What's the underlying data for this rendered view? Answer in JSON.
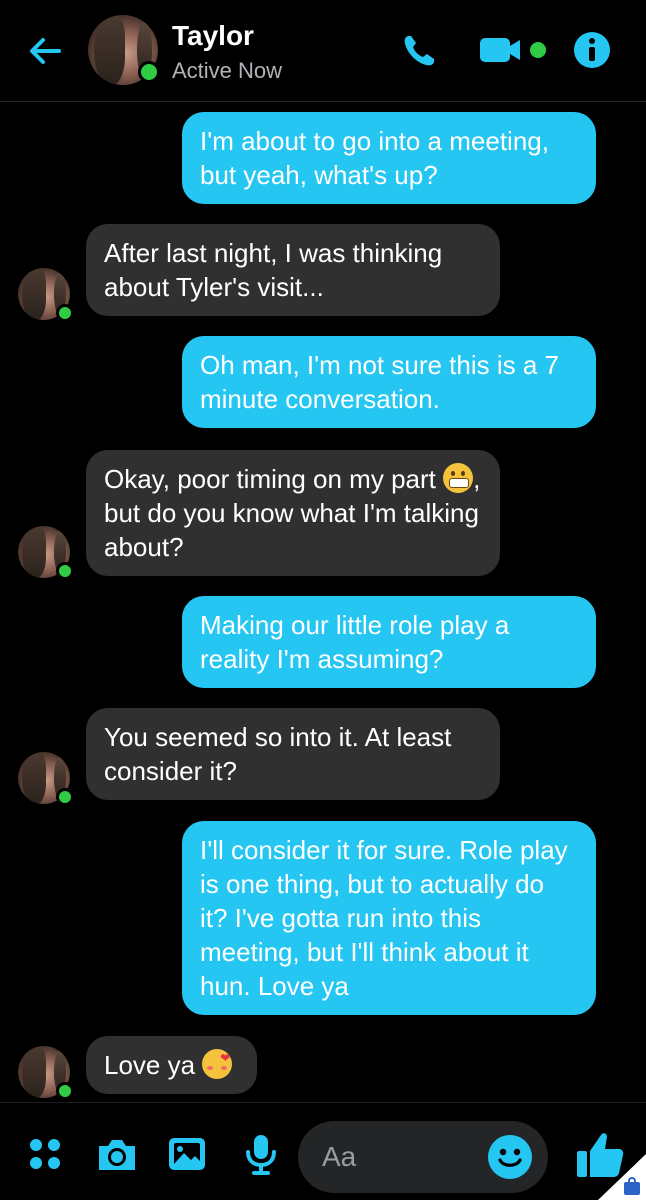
{
  "header": {
    "contact_name": "Taylor",
    "status": "Active Now",
    "icons": [
      "back-arrow-icon",
      "phone-icon",
      "video-camera-icon",
      "info-icon"
    ]
  },
  "messages": [
    {
      "sender": "me",
      "text": "I'm about to go into a meeting, but yeah, what's up?"
    },
    {
      "sender": "Taylor",
      "text": "After last night, I was thinking about Tyler's visit..."
    },
    {
      "sender": "me",
      "text": "Oh man, I'm not sure this is a 7 minute conversation."
    },
    {
      "sender": "Taylor",
      "text_before": "Okay, poor timing on my part ",
      "emoji": "grimacing-face",
      "text_after": ", but do you know what I'm talking about?"
    },
    {
      "sender": "me",
      "text": "Making our little role play a reality I'm assuming?"
    },
    {
      "sender": "Taylor",
      "text": "You seemed so into it. At least consider it?"
    },
    {
      "sender": "me",
      "text": "I'll consider it for sure. Role play is one thing, but to actually do it? I've gotta run into this meeting, but I'll think about it hun. Love ya"
    },
    {
      "sender": "Taylor",
      "text": "Love ya ",
      "emoji": "smiling-face-with-hearts"
    }
  ],
  "composer": {
    "placeholder": "Aa",
    "icons": [
      "apps-grid-icon",
      "camera-icon",
      "gallery-icon",
      "microphone-icon",
      "emoji-icon",
      "thumbs-up-icon"
    ]
  },
  "colors": {
    "accent": "#25c6f2",
    "incoming_bubble": "#303030",
    "background": "#000000",
    "online": "#31cc46"
  }
}
